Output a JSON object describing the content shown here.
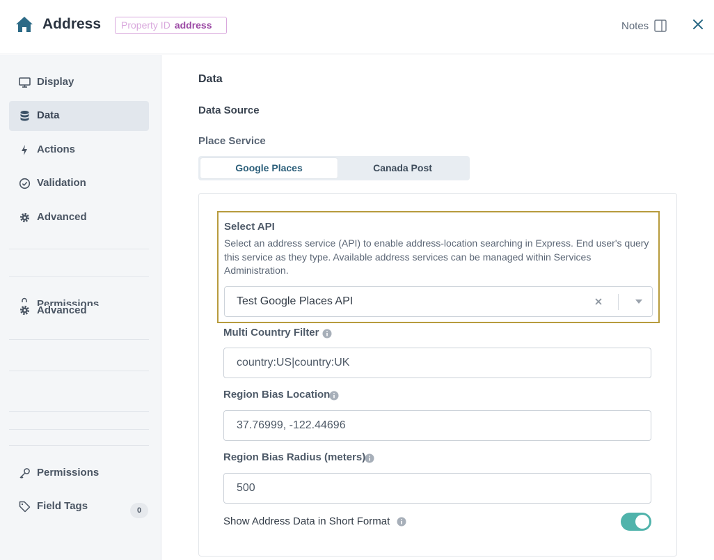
{
  "header": {
    "title": "Address",
    "property_id_label": "Property ID",
    "property_id_value": "address",
    "notes_label": "Notes"
  },
  "sidebar": {
    "items": [
      {
        "label": "Display",
        "icon": "monitor-icon"
      },
      {
        "label": "Data",
        "icon": "database-icon",
        "active": true
      },
      {
        "label": "Actions",
        "icon": "lightning-icon"
      },
      {
        "label": "Validation",
        "icon": "check-circle-icon"
      },
      {
        "label": "Advanced",
        "icon": "gear-icon"
      }
    ],
    "ghost_label_top": "Permissions",
    "ghost_label_bottom": "Advanced",
    "bottom_items": [
      {
        "label": "Permissions",
        "icon": "key-icon"
      },
      {
        "label": "Field Tags",
        "icon": "tag-icon",
        "count": "0"
      }
    ]
  },
  "main": {
    "section_title": "Data",
    "data_source_label": "Data Source",
    "place_service_label": "Place Service",
    "place_service_options": [
      "Google Places",
      "Canada Post"
    ],
    "place_service_selected": "Google Places",
    "select_api": {
      "label": "Select API",
      "description": "Select an address service (API) to enable address-location searching in Express. End user's query this service as they type. Available address services can be managed within Services Administration.",
      "value": "Test Google Places API"
    },
    "multi_country_filter": {
      "label": "Multi Country Filter",
      "value": "country:US|country:UK"
    },
    "region_bias_location": {
      "label": "Region Bias Location",
      "value": "37.76999, -122.44696"
    },
    "region_bias_radius": {
      "label": "Region Bias Radius (meters)",
      "value": "500"
    },
    "short_format": {
      "label": "Show Address Data in Short Format",
      "enabled": true
    }
  },
  "colors": {
    "accent_teal": "#50b3ab",
    "highlight_border": "#b79b3d",
    "property_badge": "#9c4aa5",
    "sidebar_bg": "#f4f6f8"
  }
}
